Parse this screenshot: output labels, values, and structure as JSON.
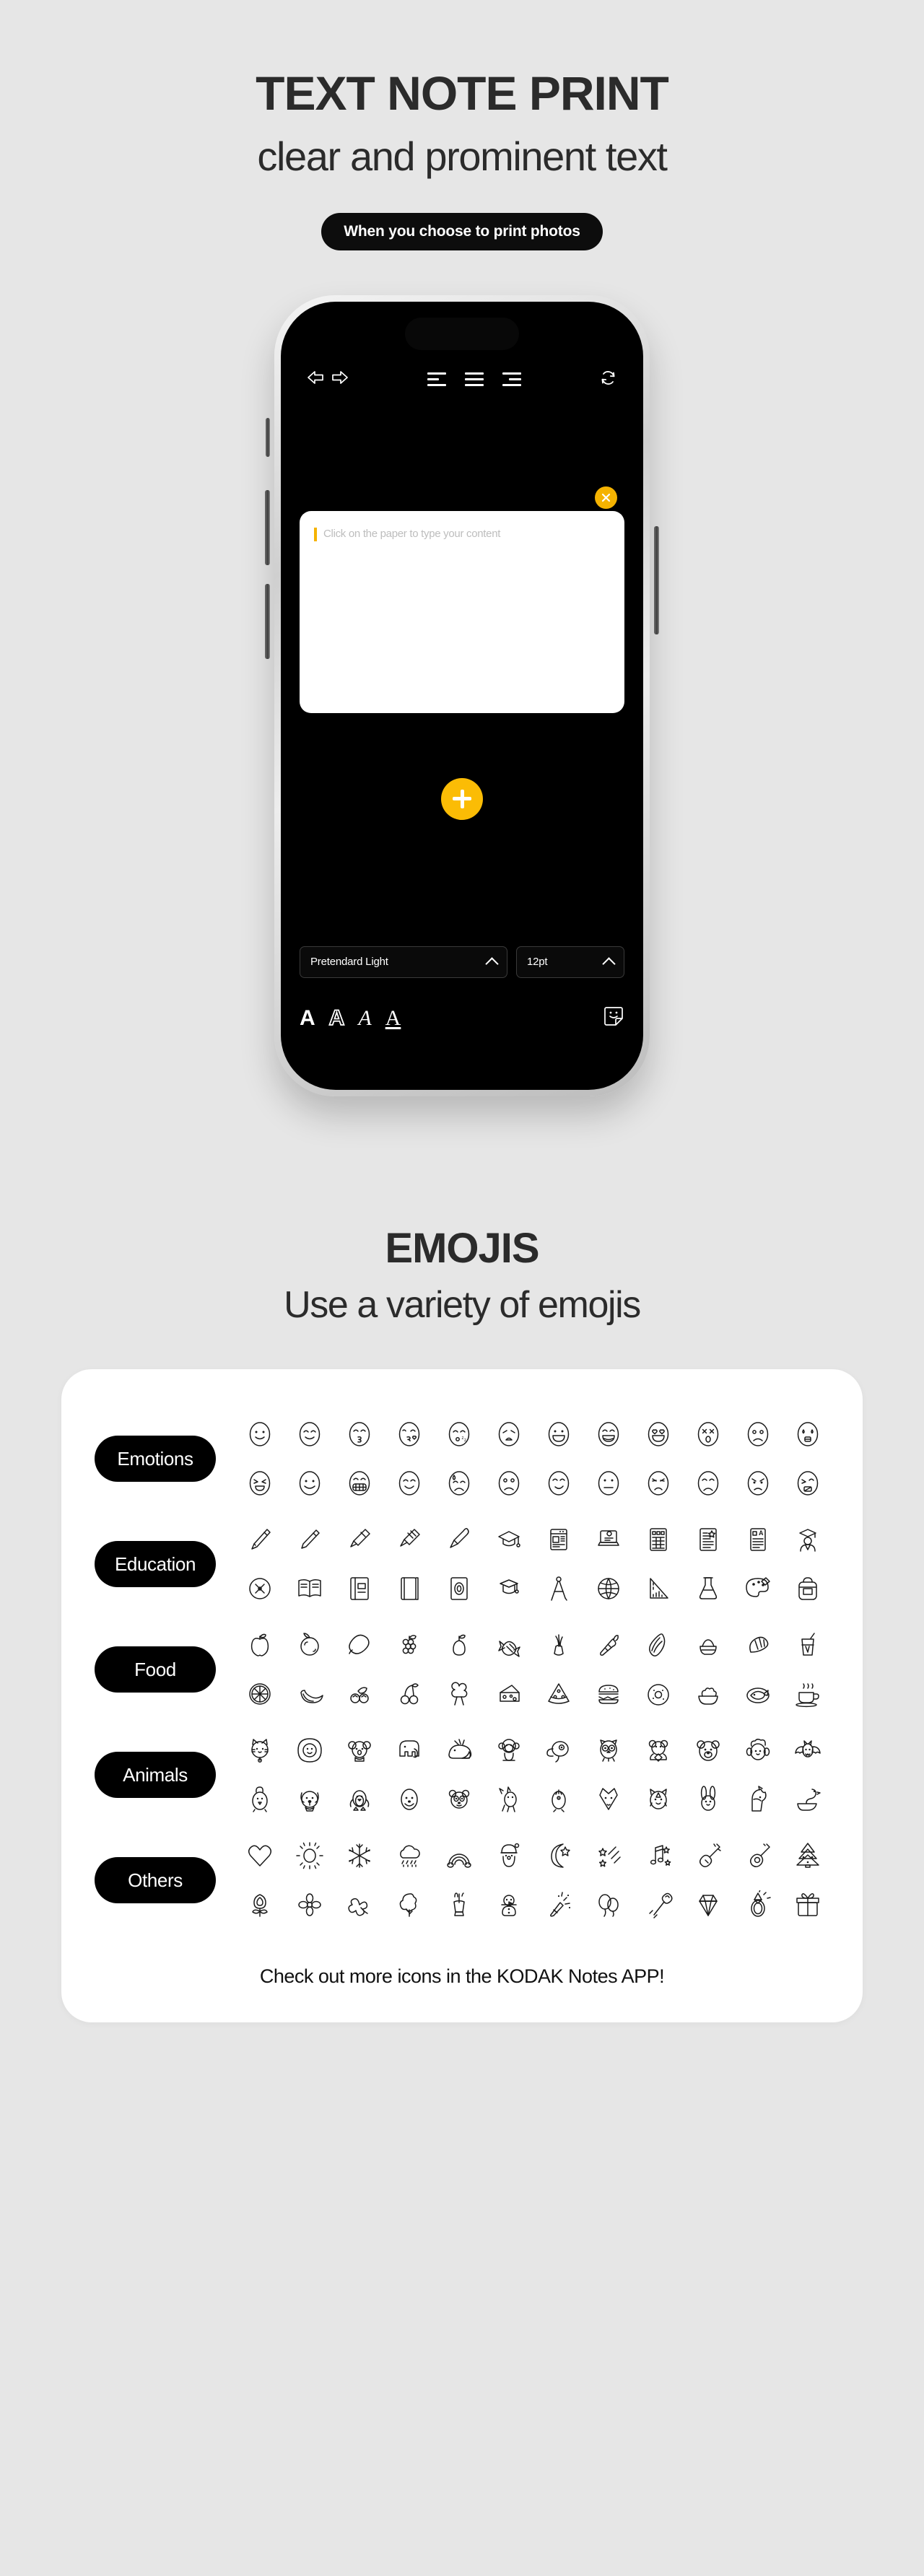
{
  "section_one": {
    "title": "TEXT NOTE PRINT",
    "subtitle": "clear and prominent text",
    "badge": "When you choose to print photos"
  },
  "phone": {
    "toolbar": {
      "undo_icon": "undo-arrow-icon",
      "redo_icon": "redo-arrow-icon",
      "align_left_icon": "align-left-icon",
      "align_center_icon": "align-center-icon",
      "align_right_icon": "align-right-icon",
      "rotate_icon": "rotate-refresh-icon"
    },
    "note": {
      "close_icon": "close-x-icon",
      "placeholder": "Click on the paper to type your content",
      "text_value": ""
    },
    "add_button_icon": "plus-icon",
    "controls": {
      "font_family_value": "Pretendard Light",
      "font_family_chevron": "chevron-up-icon",
      "font_size_value": "12pt",
      "font_size_chevron": "chevron-up-icon",
      "style_buttons": [
        {
          "glyph": "A",
          "name": "bold-text-button"
        },
        {
          "glyph": "A",
          "name": "outline-text-button"
        },
        {
          "glyph": "A",
          "name": "italic-text-button"
        },
        {
          "glyph": "A",
          "name": "underline-text-button"
        }
      ],
      "sticker_icon": "emoji-sticker-icon"
    }
  },
  "section_two": {
    "title": "EMOJIS",
    "subtitle": "Use a variety of emojis",
    "footer": "Check out more icons in the KODAK Notes APP!",
    "categories": [
      {
        "label": "Emotions",
        "rows": [
          [
            "smile-face-icon",
            "happy-face-icon",
            "kiss-face-icon",
            "kiss-heart-face-icon",
            "sleepy-face-icon",
            "worried-face-icon",
            "grin-face-icon",
            "laugh-face-icon",
            "heart-eyes-face-icon",
            "dizzy-face-icon",
            "sad-face-icon",
            "sweat-face-icon"
          ],
          [
            "grin-squint-face-icon",
            "neutral-smile-face-icon",
            "teeth-grin-face-icon",
            "blush-face-icon",
            "cry-sweat-face-icon",
            "frown-face-icon",
            "smirk-face-icon",
            "expressionless-face-icon",
            "distress-face-icon",
            "pout-face-icon",
            "angry-face-icon",
            "sleep-face-icon"
          ]
        ]
      },
      {
        "label": "Education",
        "rows": [
          [
            "fountain-pen-icon",
            "pencil-icon",
            "marker-icon",
            "highlighter-icon",
            "paintbrush-icon",
            "graduation-cap-icon",
            "document-page-icon",
            "laptop-lesson-icon",
            "spreadsheet-icon",
            "certificate-icon",
            "report-card-icon",
            "graduate-student-icon"
          ],
          [
            "compass-tool-icon",
            "open-book-icon",
            "notebook-icon",
            "closed-book-icon",
            "diploma-book-icon",
            "graduation-hat-icon",
            "drawing-compass-icon",
            "globe-icon",
            "triangle-ruler-icon",
            "flask-icon",
            "palette-icon",
            "backpack-icon"
          ]
        ]
      },
      {
        "label": "Food",
        "rows": [
          [
            "apple-icon",
            "orange-icon",
            "lemon-icon",
            "grapes-icon",
            "pear-icon",
            "candy-icon",
            "leek-icon",
            "carrot-icon",
            "corn-icon",
            "rice-bowl-icon",
            "croissant-icon",
            "drink-glass-icon"
          ],
          [
            "orange-slice-icon",
            "banana-icon",
            "blueberries-icon",
            "cherries-icon",
            "broccoli-icon",
            "cheese-icon",
            "pizza-slice-icon",
            "burger-icon",
            "bagel-icon",
            "salad-bowl-icon",
            "fish-plate-icon",
            "coffee-cup-icon"
          ]
        ]
      },
      {
        "label": "Animals",
        "rows": [
          [
            "cat-icon",
            "lion-icon",
            "koala-icon",
            "elephant-icon",
            "whale-icon",
            "monkey-icon",
            "toucan-icon",
            "owl-icon",
            "bear-cub-icon",
            "bear-icon",
            "sheep-icon",
            "bat-icon"
          ],
          [
            "chicken-icon",
            "dog-icon",
            "penguin-icon",
            "seal-icon",
            "panda-icon",
            "deer-icon",
            "chick-icon",
            "fox-icon",
            "tiger-icon",
            "rabbit-icon",
            "horse-icon",
            "swan-icon"
          ]
        ]
      },
      {
        "label": "Others",
        "rows": [
          [
            "heart-icon",
            "sun-icon",
            "snowflake-icon",
            "rain-cloud-icon",
            "rainbow-icon",
            "santa-icon",
            "moon-star-icon",
            "shooting-stars-icon",
            "music-notes-icon",
            "electric-guitar-icon",
            "acoustic-guitar-icon",
            "christmas-tree-icon"
          ],
          [
            "rose-icon",
            "flower-icon",
            "clover-icon",
            "tree-icon",
            "cactus-icon",
            "snowman-icon",
            "party-popper-icon",
            "balloons-icon",
            "magic-wand-icon",
            "diamond-icon",
            "ring-icon",
            "gift-box-icon"
          ]
        ]
      }
    ]
  },
  "colors": {
    "background": "#e6e6e6",
    "accent_yellow": "#fbbc05",
    "card_white": "#ffffff",
    "chip_black": "#000000",
    "text_dark": "#2b2b2b"
  }
}
